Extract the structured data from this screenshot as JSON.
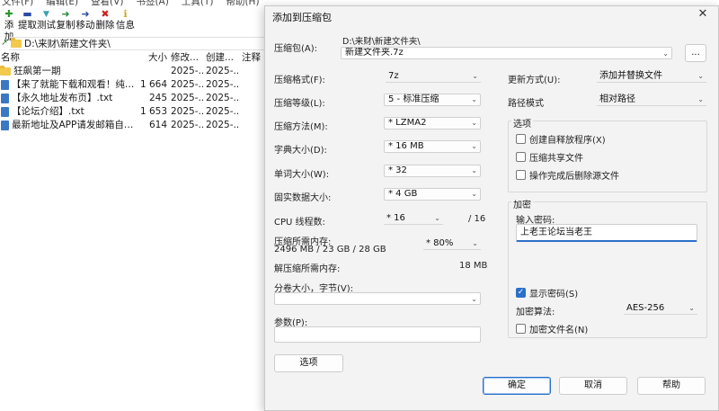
{
  "file_manager": {
    "menu": [
      "文件(F)",
      "编辑(E)",
      "查看(V)",
      "书签(A)",
      "工具(T)",
      "帮助(H)"
    ],
    "toolbar": [
      {
        "label": "添加",
        "icon": "add-icon",
        "glyph": "✚",
        "color": "#2a9a2a"
      },
      {
        "label": "提取",
        "icon": "extract-icon",
        "glyph": "▬",
        "color": "#2a4aa8"
      },
      {
        "label": "测试",
        "icon": "test-icon",
        "glyph": "▼",
        "color": "#3aa0b0"
      },
      {
        "label": "复制",
        "icon": "copy-icon",
        "glyph": "➜",
        "color": "#2a8a3a"
      },
      {
        "label": "移动",
        "icon": "move-icon",
        "glyph": "➜",
        "color": "#2a4aa8"
      },
      {
        "label": "删除",
        "icon": "delete-icon",
        "glyph": "✖",
        "color": "#cc2222"
      },
      {
        "label": "信息",
        "icon": "info-icon",
        "glyph": "ℹ",
        "color": "#c9a21a"
      }
    ],
    "path": "D:\\来财\\新建文件夹\\",
    "columns": {
      "name": "名称",
      "size": "大小",
      "modified": "修改...",
      "created": "创建...",
      "note": "注释"
    },
    "rows": [
      {
        "name": "狂飙第一期",
        "type": "folder",
        "size": "",
        "modified": "2025-...",
        "created": "2025-..."
      },
      {
        "name": "【来了就能下载和观看！纯免...",
        "type": "file",
        "size": "1 664",
        "modified": "2025-...",
        "created": "2025-..."
      },
      {
        "name": "【永久地址发布页】.txt",
        "type": "file",
        "size": "245",
        "modified": "2025-...",
        "created": "2025-..."
      },
      {
        "name": "【论坛介绍】.txt",
        "type": "file",
        "size": "1 653",
        "modified": "2025-...",
        "created": "2025-..."
      },
      {
        "name": "最新地址及APP请发邮箱自动...",
        "type": "file",
        "size": "614",
        "modified": "2025-...",
        "created": "2025-..."
      }
    ]
  },
  "dialog": {
    "title": "添加到压缩包",
    "archive_label": "压缩包(A):",
    "archive_dir": "D:\\来财\\新建文件夹\\",
    "archive_name": "新建文件夹.7z",
    "browse_label": "...",
    "format_label": "压缩格式(F):",
    "format_value": "7z",
    "level_label": "压缩等级(L):",
    "level_value": "5 - 标准压缩",
    "method_label": "压缩方法(M):",
    "method_value": "*  LZMA2",
    "dict_label": "字典大小(D):",
    "dict_value": "*  16 MB",
    "word_label": "单词大小(W):",
    "word_value": "*  32",
    "solid_label": "固实数据大小:",
    "solid_value": "*  4 GB",
    "threads_label": "CPU 线程数:",
    "threads_value": "*  16",
    "threads_max": "/ 16",
    "mem_label": "压缩所需内存:",
    "mem_value": "2496 MB / 23 GB / 28 GB",
    "mem_percent": "*  80%",
    "decomp_label": "解压缩所需内存:",
    "decomp_value": "18 MB",
    "split_label": "分卷大小，字节(V):",
    "split_value": "",
    "params_label": "参数(P):",
    "params_value": "",
    "options_btn": "选项",
    "update_label": "更新方式(U):",
    "update_value": "添加并替换文件",
    "pathmode_label": "路径模式",
    "pathmode_value": "相对路径",
    "options_group": "选项",
    "opt_sfx": "创建自释放程序(X)",
    "opt_shared": "压缩共享文件",
    "opt_delete": "操作完成后删除源文件",
    "encrypt_group": "加密",
    "pw_label": "输入密码:",
    "pw_value": "上老王论坛当老王",
    "show_pw": "显示密码(S)",
    "enc_method_label": "加密算法:",
    "enc_method_value": "AES-256",
    "enc_names": "加密文件名(N)",
    "ok": "确定",
    "cancel": "取消",
    "help": "帮助"
  },
  "colors": {
    "accent": "#2a6fc9",
    "dialog_bg": "#f3f3f3"
  }
}
